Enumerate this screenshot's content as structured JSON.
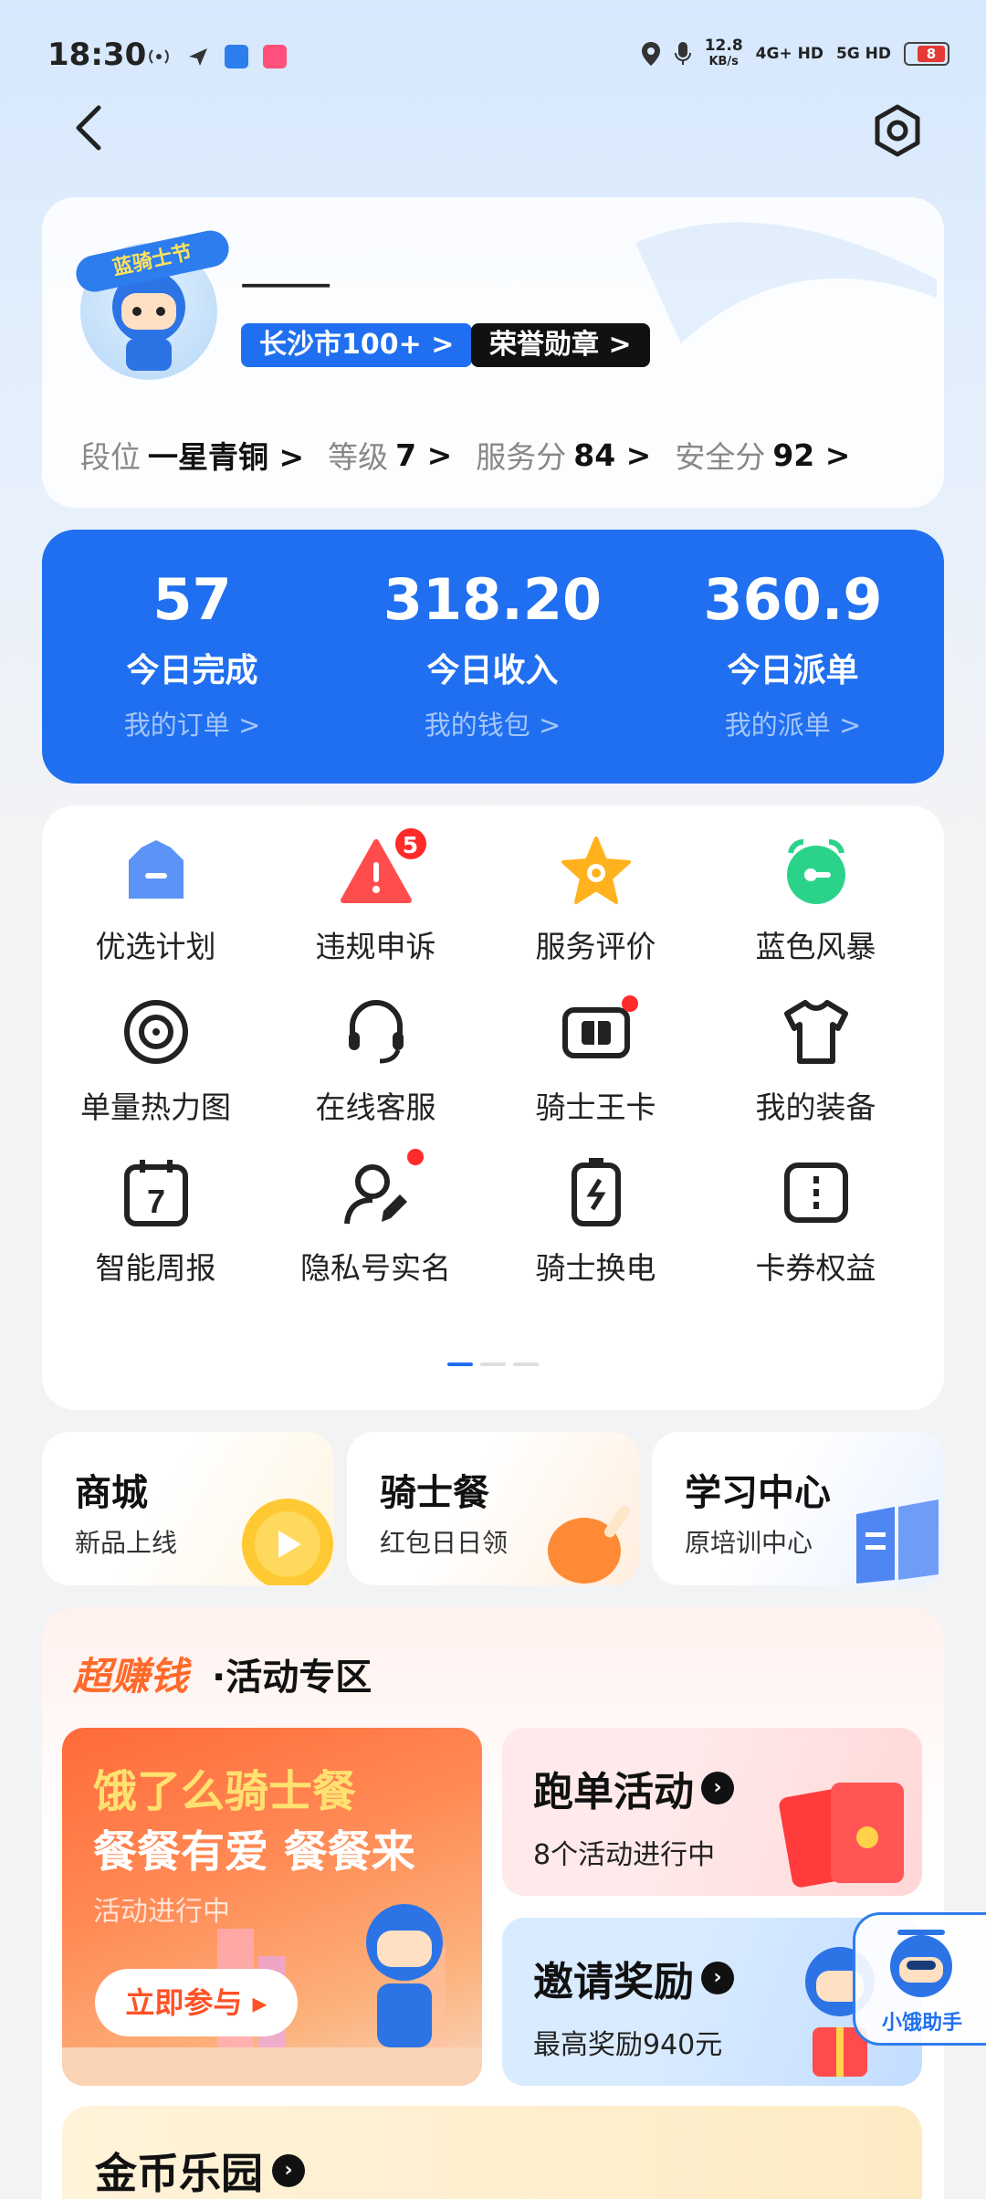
{
  "status_bar": {
    "time": "18:30",
    "speed": "12.8",
    "speed_unit": "KB/s",
    "net1": "4G+ HD",
    "net2": "5G HD",
    "battery": "8"
  },
  "profile": {
    "name": "⸻",
    "city_chip": "长沙市100+ >",
    "honor_chip": "荣誉勋章 >",
    "avatar_badge": "蓝骑士节",
    "stats": [
      {
        "key": "段位",
        "value": "一星青铜 >"
      },
      {
        "key": "等级",
        "value": "7 >"
      },
      {
        "key": "服务分",
        "value": "84 >"
      },
      {
        "key": "安全分",
        "value": "92 >"
      }
    ]
  },
  "today": [
    {
      "number": "57",
      "label": "今日完成",
      "link": "我的订单 >"
    },
    {
      "number": "318.20",
      "label": "今日收入",
      "link": "我的钱包 >"
    },
    {
      "number": "360.9",
      "label": "今日派单",
      "link": "我的派单 >"
    }
  ],
  "grid": [
    {
      "label": "优选计划",
      "icon": "crown-icon"
    },
    {
      "label": "违规申诉",
      "icon": "alert-icon",
      "badge": "5"
    },
    {
      "label": "服务评价",
      "icon": "star-icon"
    },
    {
      "label": "蓝色风暴",
      "icon": "alarm-clock-icon"
    },
    {
      "label": "单量热力图",
      "icon": "target-icon"
    },
    {
      "label": "在线客服",
      "icon": "headset-icon"
    },
    {
      "label": "骑士王卡",
      "icon": "sim-card-icon",
      "dot": true
    },
    {
      "label": "我的装备",
      "icon": "tshirt-icon"
    },
    {
      "label": "智能周报",
      "icon": "calendar-icon",
      "calendar_day": "7"
    },
    {
      "label": "隐私号实名",
      "icon": "user-edit-icon",
      "dot": true
    },
    {
      "label": "骑士换电",
      "icon": "battery-swap-icon"
    },
    {
      "label": "卡券权益",
      "icon": "coupon-icon"
    }
  ],
  "shortcuts": [
    {
      "title": "商城",
      "subtitle": "新品上线"
    },
    {
      "title": "骑士餐",
      "subtitle": "红包日日领"
    },
    {
      "title": "学习中心",
      "subtitle": "原培训中心"
    }
  ],
  "activity": {
    "hot_label": "超赚钱",
    "section_title": "·活动专区",
    "promo": {
      "line1": "饿了么骑士餐",
      "line2": "餐餐有爱 餐餐来",
      "line3": "活动进行中",
      "button": "立即参与 ▸"
    },
    "run": {
      "title": "跑单活动",
      "subtitle": "8个活动进行中"
    },
    "invite": {
      "title": "邀请奖励",
      "subtitle": "最高奖励940元"
    }
  },
  "gold": {
    "title": "金币乐园"
  },
  "helper": {
    "label": "小饿助手"
  },
  "colors": {
    "primary": "#1f6ff0",
    "alert": "#ff2b2b",
    "orange": "#ff6a2b"
  }
}
